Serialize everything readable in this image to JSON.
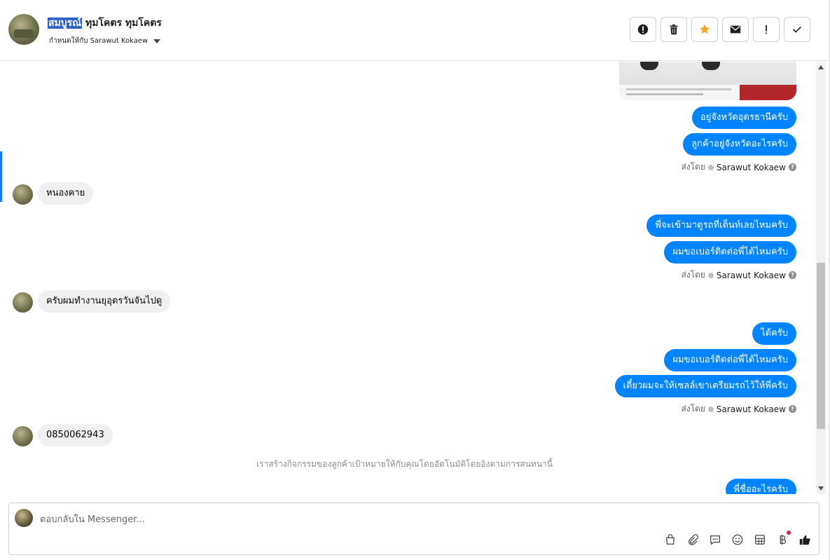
{
  "header": {
    "name_selected": "สมบูรณ์",
    "name_rest": " ทุมโคตร ทุมโคตร",
    "assigned_label": "กำหนดให้กับ Sarawut Kokaew"
  },
  "thread": {
    "messages": [
      {
        "text": "อยู่จังหวัดอุดรธานีครับ"
      },
      {
        "text": "ลูกค้าอยู่จังหวัดอะไรครับ"
      },
      {
        "text": "หนองคาย"
      },
      {
        "text": "พี่จะเข้ามาดูรถที่เต็นท์เลยไหมครับ"
      },
      {
        "text": "ผมขอเบอร์ติดต่อพี่ได้ไหมครับ"
      },
      {
        "text": "ครับผมทำงานยุอุดรวันจันไปดู"
      },
      {
        "text": "ได้ครับ"
      },
      {
        "text": "ผมขอเบอร์ติดต่อพี่ได้ไหมครับ"
      },
      {
        "text": "เดี๋ยวผมจะให้เซลล์เขาเตรียมรถไว้ให้พี่ครับ"
      },
      {
        "text": "0850062943"
      },
      {
        "text": "พี่ชื่ออะไรครับ"
      }
    ],
    "sent_by_prefix": "ส่งโดย",
    "sent_by_agent": "Sarawut Kokaew",
    "help_glyph": "?",
    "system_note": "เราสร้างกิจกรรมของลูกค้าเป้าหมายให้กับคุณโดยอัตโนมัติโดยอิงตามการสนทนานี้"
  },
  "composer": {
    "placeholder": "ตอบกลับใน Messenger..."
  },
  "colors": {
    "outgoing_bubble": "#0084ff",
    "incoming_bubble": "#f0f0f0",
    "star_accent": "#f5a623",
    "badge_red": "#e41e3f",
    "selection": "#2f62c7"
  },
  "icons": {
    "header_actions": [
      "alert-circle-icon",
      "trash-icon",
      "star-icon",
      "mail-icon",
      "exclamation-icon",
      "check-icon"
    ],
    "composer_tools": [
      "shopping-bag-icon",
      "paperclip-icon",
      "chat-bubble-icon",
      "emoji-icon",
      "table-icon",
      "baht-icon",
      "thumbs-up-icon"
    ]
  }
}
